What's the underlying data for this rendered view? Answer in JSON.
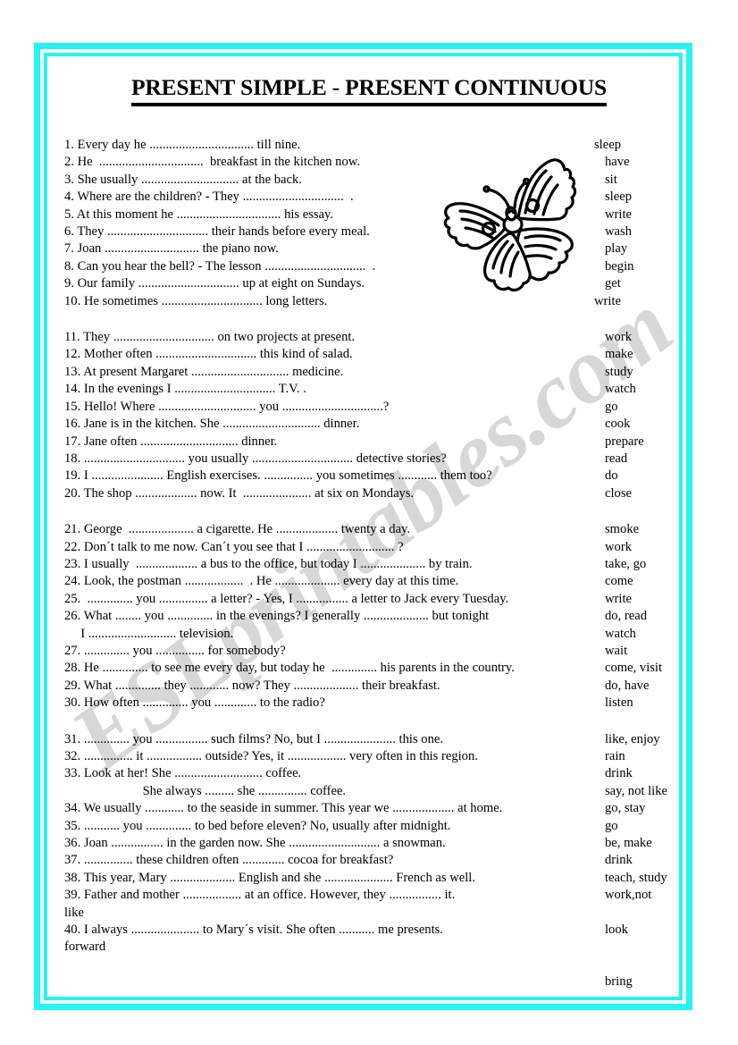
{
  "title": "PRESENT SIMPLE - PRESENT CONTINUOUS",
  "watermark": "ESLprintables.com",
  "colors": {
    "frame": "#25f4f4",
    "text": "#000000",
    "watermark": "#c9c9c9"
  },
  "illustration": {
    "name": "butterfly",
    "style": "black outline clipart"
  },
  "blocks": [
    {
      "id": "block-1",
      "rows": [
        {
          "q": "1. Every day he ................................ till nine.",
          "verb": "sleep",
          "verb_indent": false
        },
        {
          "q": "2. He  ................................  breakfast in the kitchen now.",
          "verb": "have",
          "verb_indent": true
        },
        {
          "q": "3. She usually .............................. at the back.",
          "verb": "sit",
          "verb_indent": true
        },
        {
          "q": "4. Where are the children? - They ...............................  .",
          "verb": "sleep",
          "verb_indent": true
        },
        {
          "q": "5. At this moment he ................................ his essay.",
          "verb": "write",
          "verb_indent": true
        },
        {
          "q": "6. They ............................... their hands before every meal.",
          "verb": "wash",
          "verb_indent": true
        },
        {
          "q": "7. Joan ............................. the piano now.",
          "verb": "play",
          "verb_indent": true
        },
        {
          "q": "8. Can you hear the bell? - The lesson ...............................  .",
          "verb": "begin",
          "verb_indent": true
        },
        {
          "q": "9. Our family ............................... up at eight on Sundays.",
          "verb": "get",
          "verb_indent": true
        },
        {
          "q": "10. He sometimes ............................... long letters.",
          "verb": "write",
          "verb_indent": false
        }
      ]
    },
    {
      "id": "block-2",
      "rows": [
        {
          "q": "11. They ............................... on two projects at present.",
          "verb": "work",
          "verb_indent": true
        },
        {
          "q": "12. Mother often ............................... this kind of salad.",
          "verb": "make",
          "verb_indent": true
        },
        {
          "q": "13. At present Margaret .............................. medicine.",
          "verb": "study",
          "verb_indent": true
        },
        {
          "q": "14. In the evenings I ............................... T.V. .",
          "verb": "watch",
          "verb_indent": true
        },
        {
          "q": "15. Hello! Where .............................. you ...............................?",
          "verb": "go",
          "verb_indent": true
        },
        {
          "q": "16. Jane is in the kitchen. She .............................. dinner.",
          "verb": "cook",
          "verb_indent": true
        },
        {
          "q": "17. Jane often .............................. dinner.",
          "verb": "prepare",
          "verb_indent": true
        },
        {
          "q": "18. ............................... you usually ............................... detective stories?",
          "verb": "read",
          "verb_indent": true
        },
        {
          "q": "19. I ...................... English exercises. ............... you sometimes ............ them too?",
          "verb": "do",
          "verb_indent": true
        },
        {
          "q": "20. The shop ................... now. It  ..................... at six on Mondays.",
          "verb": "close",
          "verb_indent": true
        }
      ]
    },
    {
      "id": "block-3",
      "rows": [
        {
          "q": "21. George  .................... a cigarette. He ................... twenty a day.",
          "verb": "smoke",
          "verb_indent": true
        },
        {
          "q": "22. Don´t talk to me now. Can´t you see that I ........................... ?",
          "verb": "work",
          "verb_indent": true
        },
        {
          "q": "23. I usually  ................... a bus to the office, but today I .................... by train.",
          "verb": "take, go",
          "verb_indent": true
        },
        {
          "q": "24. Look, the postman ..................  . He .................... every day at this time.",
          "verb": "come",
          "verb_indent": true
        },
        {
          "q": "25.  .............. you ............... a letter? - Yes, I ................ a letter to Jack every Tuesday.",
          "verb": "write",
          "verb_indent": true
        },
        {
          "q": "26. What ........ you .............. in the evenings? I generally .................... but tonight",
          "verb": "do, read",
          "verb_indent": true
        },
        {
          "q": "     I ........................... television.",
          "verb": "watch",
          "verb_indent": true,
          "continuation": true
        },
        {
          "q": "27. .............. you ............... for somebody?",
          "verb": "wait",
          "verb_indent": true
        },
        {
          "q": "28. He .............. to see me every day, but today he  .............. his parents in the country.",
          "verb": "come, visit",
          "verb_indent": true
        },
        {
          "q": "29. What .............. they ............ now? They .................... their breakfast.",
          "verb": "do, have",
          "verb_indent": true
        },
        {
          "q": "30. How often .............. you ............. to the radio?",
          "verb": "listen",
          "verb_indent": true
        }
      ]
    },
    {
      "id": "block-4",
      "rows": [
        {
          "q": "31. .............. you ................ such films? No, but I ...................... this one.",
          "verb": "like, enjoy",
          "verb_indent": true
        },
        {
          "q": "32. ............... it ................. outside? Yes, it .................. very often in this region.",
          "verb": "rain",
          "verb_indent": true
        },
        {
          "q": "33. Look at her! She ........................... coffee.",
          "verb": "drink",
          "verb_indent": true
        },
        {
          "q": "                        She always ......... she ............... coffee.",
          "verb": "say, not like",
          "verb_indent": true,
          "continuation": true
        },
        {
          "q": "34. We usually ............ to the seaside in summer. This year we ................... at home.",
          "verb": "go, stay",
          "verb_indent": true
        },
        {
          "q": "35. ........... you .............. to bed before eleven? No, usually after midnight.",
          "verb": "go",
          "verb_indent": true
        },
        {
          "q": "36. Joan ................ in the garden now. She ............................ a snowman.",
          "verb": "be, make",
          "verb_indent": true
        },
        {
          "q": "37. ............... these children often ............. cocoa for breakfast?",
          "verb": "drink",
          "verb_indent": true
        },
        {
          "q": "38. This year, Mary .................... English and she ..................... French as well.",
          "verb": "teach, study",
          "verb_indent": true
        },
        {
          "q": "39. Father and mother .................. at an office. However, they ................ it.",
          "verb": "work,not",
          "verb_indent": true
        },
        {
          "q": "like",
          "verb": "",
          "verb_indent": true,
          "overflow": true
        },
        {
          "q": "40. I always ..................... to Mary´s visit. She often ........... me presents.",
          "verb": "look",
          "verb_indent": true
        },
        {
          "q": "forward",
          "verb": "",
          "verb_indent": true,
          "overflow": true
        },
        {
          "q": "",
          "verb": "",
          "verb_indent": true,
          "spacer": true
        },
        {
          "q": "",
          "verb": "bring",
          "verb_indent": true,
          "spacer": true
        }
      ]
    }
  ]
}
